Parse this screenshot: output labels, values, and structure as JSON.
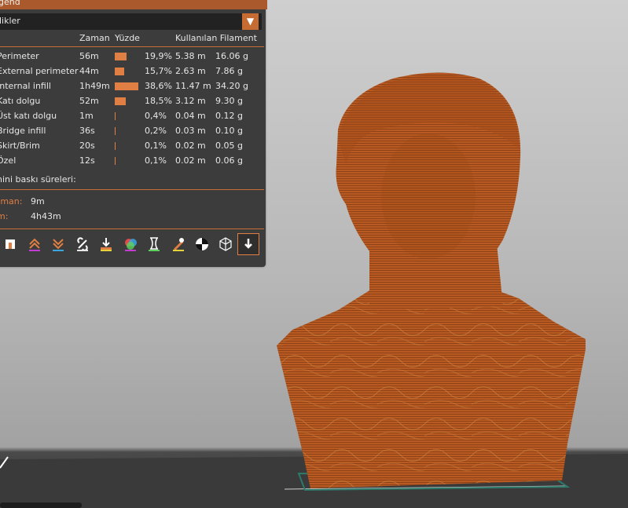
{
  "legend": {
    "title": "gend",
    "view_selector": "likler",
    "columns": {
      "time": "Zaman",
      "percent": "Yüzde",
      "used_filament": "Kullanılan Filament"
    },
    "rows": [
      {
        "name": "Perimeter",
        "time": "56m",
        "pct_value": 19.9,
        "pct": "19,9%",
        "len": "5.38 m",
        "weight": "16.06 g"
      },
      {
        "name": "External perimeter",
        "time": "44m",
        "pct_value": 15.7,
        "pct": "15,7%",
        "len": "2.63 m",
        "weight": "7.86 g"
      },
      {
        "name": "Internal infill",
        "time": "1h49m",
        "pct_value": 38.6,
        "pct": "38,6%",
        "len": "11.47 m",
        "weight": "34.20 g"
      },
      {
        "name": "Katı dolgu",
        "time": "52m",
        "pct_value": 18.5,
        "pct": "18,5%",
        "len": "3.12 m",
        "weight": "9.30 g"
      },
      {
        "name": "Üst katı dolgu",
        "time": "1m",
        "pct_value": 0.4,
        "pct": "0,4%",
        "len": "0.04 m",
        "weight": "0.12 g"
      },
      {
        "name": "Bridge infill",
        "time": "36s",
        "pct_value": 0.2,
        "pct": "0,2%",
        "len": "0.03 m",
        "weight": "0.10 g"
      },
      {
        "name": "Skirt/Brim",
        "time": "20s",
        "pct_value": 0.1,
        "pct": "0,1%",
        "len": "0.02 m",
        "weight": "0.05 g"
      },
      {
        "name": "Özel",
        "time": "12s",
        "pct_value": 0.1,
        "pct": "0,1%",
        "len": "0.02 m",
        "weight": "0.06 g"
      }
    ],
    "estimated_label": "nini baskı süreleri:",
    "estimates": [
      {
        "label": "tman:",
        "value": "9m"
      },
      {
        "label": "m:",
        "value": "4h43m"
      }
    ],
    "accent_color": "#e07f43",
    "toolbar_icons": [
      "shells-icon",
      "travel-icon",
      "wipe-icon",
      "retractions-icon",
      "deretractions-icon",
      "color-changes-icon",
      "pause-icon",
      "custom-gcode-icon",
      "seams-icon",
      "tool-marker-icon",
      "view-cube-icon",
      "download-icon"
    ]
  },
  "model": {
    "color": "#b4561f",
    "bed_outline_color": "#2c7a6a"
  }
}
